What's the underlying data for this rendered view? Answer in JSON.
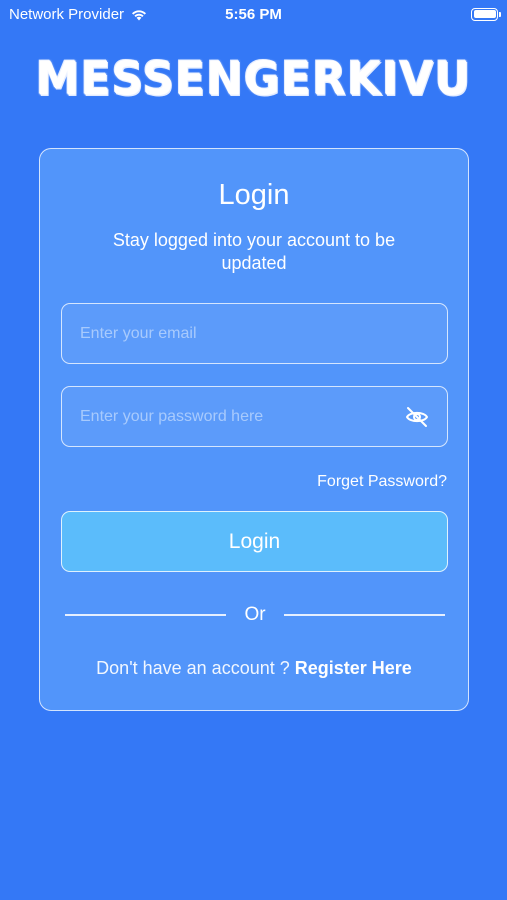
{
  "status_bar": {
    "carrier": "Network Provider",
    "time": "5:56 PM"
  },
  "app": {
    "logo_text": "MESSENGERKIVU"
  },
  "login_card": {
    "title": "Login",
    "subtitle": "Stay logged into your account to be updated",
    "email_placeholder": "Enter your email",
    "password_placeholder": "Enter your password here",
    "forget_password": "Forget Password?",
    "login_button": "Login",
    "divider_text": "Or",
    "register_prompt": "Don't have an account ? ",
    "register_link": "Register Here"
  },
  "colors": {
    "background": "#3478f6",
    "button": "#5bbcfb"
  },
  "icons": {
    "wifi": "wifi-icon",
    "battery": "battery-icon",
    "password_toggle": "eye-off-icon"
  }
}
